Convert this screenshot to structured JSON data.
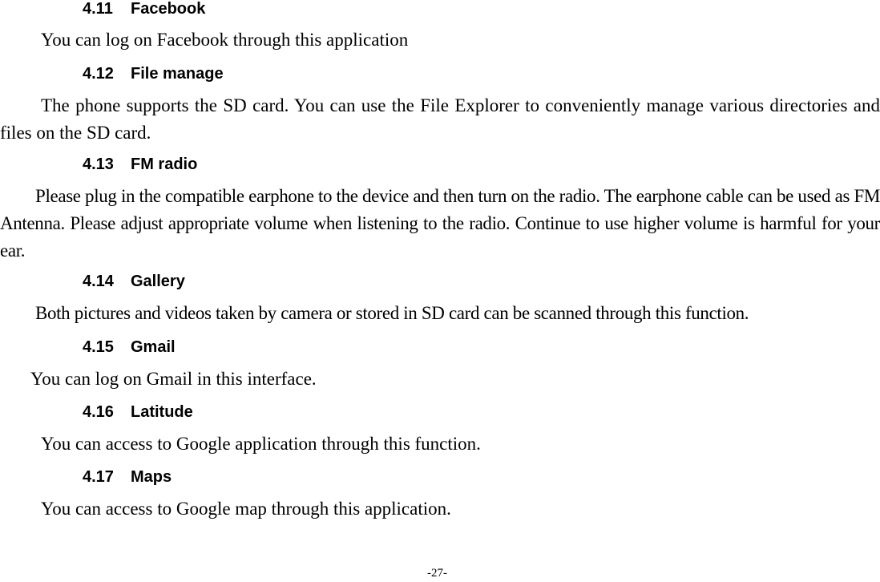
{
  "sections": [
    {
      "number": "4.11",
      "title": "Facebook",
      "paragraphs": [
        "You can log on Facebook through this application"
      ]
    },
    {
      "number": "4.12",
      "title": "File manage",
      "paragraphs": [
        "The phone supports the SD card. You can use the File Explorer to conveniently manage various directories and files on the SD card."
      ]
    },
    {
      "number": "4.13",
      "title": "FM radio",
      "paragraphs": [
        "Please plug in the compatible earphone to the device and then turn on the radio. The earphone cable can be used as FM Antenna. Please adjust appropriate volume when listening to the radio. Continue to use higher volume is harmful for your ear."
      ]
    },
    {
      "number": "4.14",
      "title": "Gallery",
      "paragraphs": [
        "Both pictures and videos taken by camera or stored in SD card can be scanned through this function."
      ]
    },
    {
      "number": "4.15",
      "title": "Gmail",
      "paragraphs": [
        "You can log on Gmail in this interface."
      ]
    },
    {
      "number": "4.16",
      "title": "Latitude",
      "paragraphs": [
        "You can access to Google application through this function."
      ]
    },
    {
      "number": "4.17",
      "title": "Maps",
      "paragraphs": [
        "You can access to Google map through this application."
      ]
    }
  ],
  "footer": {
    "page_number": "-27-"
  }
}
